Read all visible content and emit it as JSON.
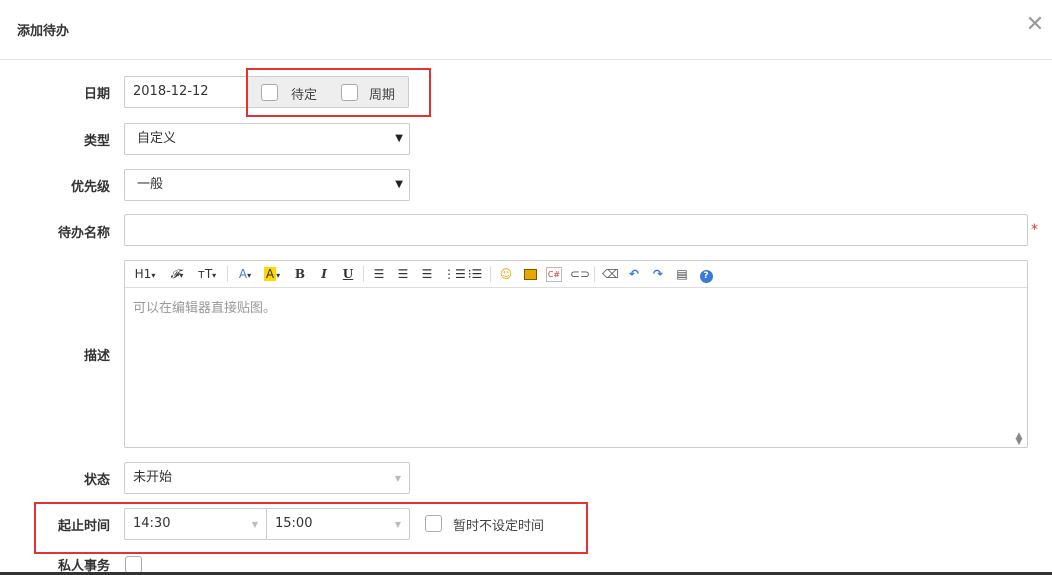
{
  "dialog": {
    "title": "添加待办",
    "close_symbol": "✕"
  },
  "form": {
    "date": {
      "label": "日期",
      "value": "2018-12-12",
      "options": {
        "pending_label": "待定",
        "cycle_label": "周期"
      }
    },
    "type": {
      "label": "类型",
      "value": "自定义"
    },
    "priority": {
      "label": "优先级",
      "value": "一般"
    },
    "name": {
      "label": "待办名称",
      "value": "",
      "required_mark": "*"
    },
    "description": {
      "label": "描述",
      "placeholder": "可以在编辑器直接贴图。",
      "toolbar": [
        "heading-icon",
        "font-family-icon",
        "font-size-icon",
        "font-color-icon",
        "background-color-icon",
        "bold-icon",
        "italic-icon",
        "underline-icon",
        "align-left-icon",
        "align-center-icon",
        "align-right-icon",
        "ordered-list-icon",
        "unordered-list-icon",
        "emoticon-icon",
        "image-icon",
        "code-icon",
        "link-icon",
        "eraser-icon",
        "undo-icon",
        "redo-icon",
        "paste-icon",
        "help-icon"
      ],
      "toolbar_text": {
        "heading": "H1",
        "font_family": "𝓕",
        "font_size": "тT",
        "font_color": "A",
        "bg_color": "A",
        "bold": "B",
        "italic": "I",
        "underline": "U"
      }
    },
    "status": {
      "label": "状态",
      "value": "未开始"
    },
    "time": {
      "label": "起止时间",
      "start": "14:30",
      "end": "15:00",
      "no_time_label": "暂时不设定时间"
    },
    "private": {
      "label": "私人事务"
    }
  },
  "colors": {
    "highlight": "#e3322f",
    "required": "#e3322f",
    "help": "#3a7bd5"
  }
}
